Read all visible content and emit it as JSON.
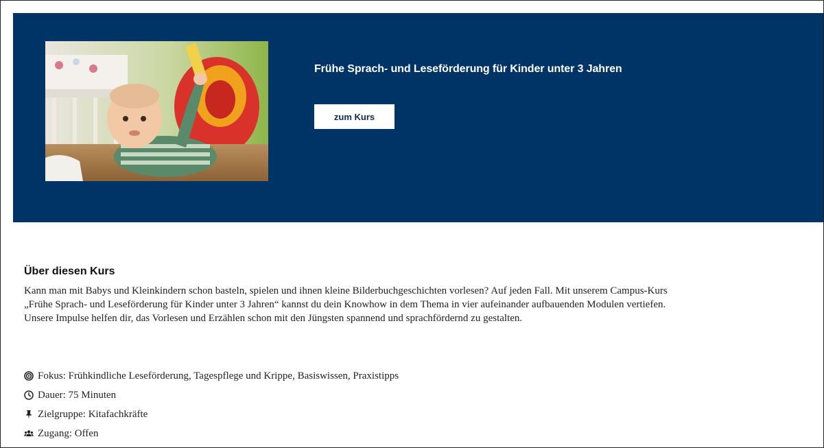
{
  "hero": {
    "title": "Frühe Sprach- und Leseförderung für Kinder unter 3 Jahren",
    "button_label": "zum Kurs",
    "background_color": "#003366",
    "image_subject": "baby-photo"
  },
  "about": {
    "heading": "Über diesen Kurs",
    "lines": [
      "Kann man mit Babys und Kleinkindern schon basteln, spielen und ihnen kleine Bilderbuchgeschichten vorlesen? Auf jeden Fall. Mit unserem Campus-Kurs",
      "„Frühe Sprach- und Leseförderung für Kinder unter 3 Jahren“ kannst du dein Knowhow in dem Thema in vier aufeinander aufbauenden Modulen vertiefen.",
      "Unsere Impulse helfen dir, das Vorlesen und Erzählen schon mit den Jüngsten spannend und sprachfördernd zu gestalten."
    ]
  },
  "facts": [
    {
      "icon": "bullseye-icon",
      "text": "Fokus: Frühkindliche Leseförderung, Tagespflege und Krippe, Basiswissen, Praxistipps"
    },
    {
      "icon": "clock-icon",
      "text": "Dauer: 75 Minuten"
    },
    {
      "icon": "pin-icon",
      "text": "Zielgruppe: Kitafachkräfte"
    },
    {
      "icon": "users-icon",
      "text": "Zugang: Offen"
    }
  ]
}
